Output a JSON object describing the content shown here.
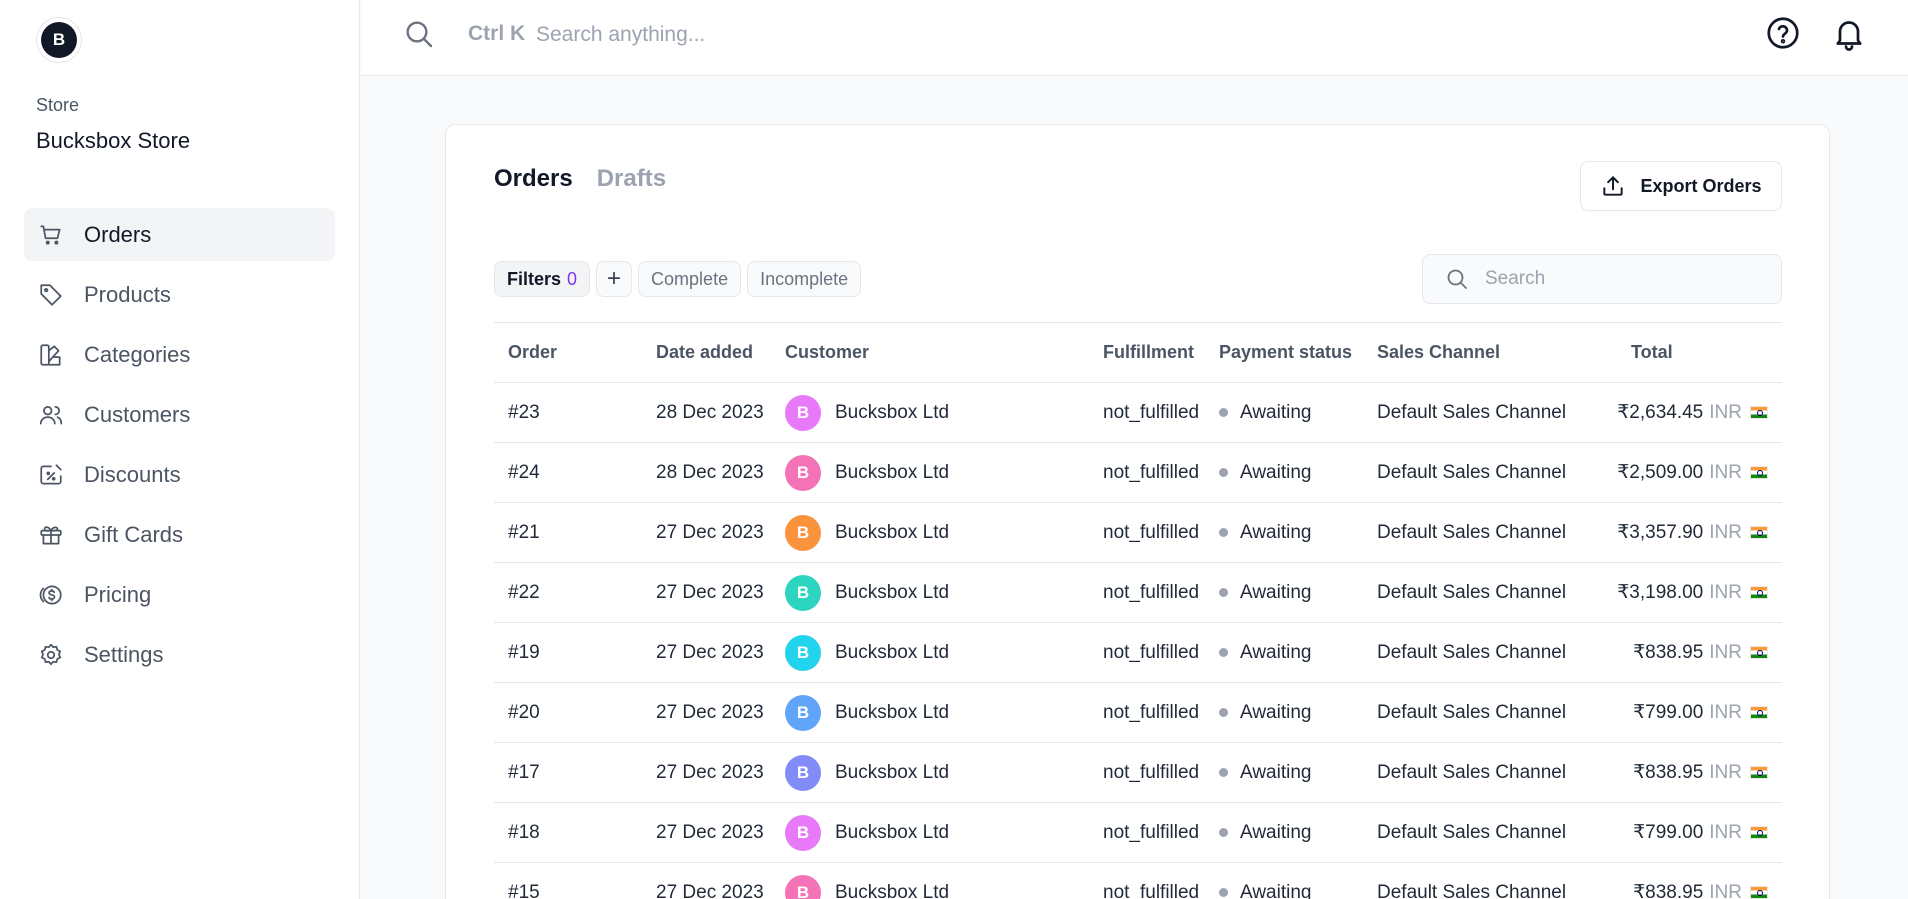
{
  "store": {
    "avatar_letter": "B",
    "label": "Store",
    "name": "Bucksbox Store"
  },
  "sidebar": {
    "items": [
      {
        "label": "Orders",
        "icon": "cart-icon",
        "active": true
      },
      {
        "label": "Products",
        "icon": "tag-icon",
        "active": false
      },
      {
        "label": "Categories",
        "icon": "swatch-icon",
        "active": false
      },
      {
        "label": "Customers",
        "icon": "users-icon",
        "active": false
      },
      {
        "label": "Discounts",
        "icon": "discount-icon",
        "active": false
      },
      {
        "label": "Gift Cards",
        "icon": "gift-icon",
        "active": false
      },
      {
        "label": "Pricing",
        "icon": "coins-icon",
        "active": false
      },
      {
        "label": "Settings",
        "icon": "gear-icon",
        "active": false
      }
    ]
  },
  "topbar": {
    "shortcut": "Ctrl K",
    "search_placeholder": "Search anything..."
  },
  "main": {
    "tabs": [
      {
        "label": "Orders",
        "active": true
      },
      {
        "label": "Drafts",
        "active": false
      }
    ],
    "export_label": "Export Orders",
    "filters_label": "Filters",
    "filters_count": "0",
    "plus_label": "+",
    "chips": [
      "Complete",
      "Incomplete"
    ],
    "search_placeholder": "Search"
  },
  "table": {
    "columns": [
      "Order",
      "Date added",
      "Customer",
      "Fulfillment",
      "Payment status",
      "Sales Channel",
      "Total"
    ],
    "rows": [
      {
        "order": "#23",
        "date": "28 Dec 2023",
        "avatar": "B",
        "avatar_color": "#e879f9",
        "customer": "Bucksbox Ltd",
        "fulfillment": "not_fulfilled",
        "payment": "Awaiting",
        "channel": "Default Sales Channel",
        "total": "₹2,634.45",
        "currency": "INR"
      },
      {
        "order": "#24",
        "date": "28 Dec 2023",
        "avatar": "B",
        "avatar_color": "#f472b6",
        "customer": "Bucksbox Ltd",
        "fulfillment": "not_fulfilled",
        "payment": "Awaiting",
        "channel": "Default Sales Channel",
        "total": "₹2,509.00",
        "currency": "INR"
      },
      {
        "order": "#21",
        "date": "27 Dec 2023",
        "avatar": "B",
        "avatar_color": "#fb923c",
        "customer": "Bucksbox Ltd",
        "fulfillment": "not_fulfilled",
        "payment": "Awaiting",
        "channel": "Default Sales Channel",
        "total": "₹3,357.90",
        "currency": "INR"
      },
      {
        "order": "#22",
        "date": "27 Dec 2023",
        "avatar": "B",
        "avatar_color": "#2dd4bf",
        "customer": "Bucksbox Ltd",
        "fulfillment": "not_fulfilled",
        "payment": "Awaiting",
        "channel": "Default Sales Channel",
        "total": "₹3,198.00",
        "currency": "INR"
      },
      {
        "order": "#19",
        "date": "27 Dec 2023",
        "avatar": "B",
        "avatar_color": "#22d3ee",
        "customer": "Bucksbox Ltd",
        "fulfillment": "not_fulfilled",
        "payment": "Awaiting",
        "channel": "Default Sales Channel",
        "total": "₹838.95",
        "currency": "INR"
      },
      {
        "order": "#20",
        "date": "27 Dec 2023",
        "avatar": "B",
        "avatar_color": "#60a5fa",
        "customer": "Bucksbox Ltd",
        "fulfillment": "not_fulfilled",
        "payment": "Awaiting",
        "channel": "Default Sales Channel",
        "total": "₹799.00",
        "currency": "INR"
      },
      {
        "order": "#17",
        "date": "27 Dec 2023",
        "avatar": "B",
        "avatar_color": "#818cf8",
        "customer": "Bucksbox Ltd",
        "fulfillment": "not_fulfilled",
        "payment": "Awaiting",
        "channel": "Default Sales Channel",
        "total": "₹838.95",
        "currency": "INR"
      },
      {
        "order": "#18",
        "date": "27 Dec 2023",
        "avatar": "B",
        "avatar_color": "#e879f9",
        "customer": "Bucksbox Ltd",
        "fulfillment": "not_fulfilled",
        "payment": "Awaiting",
        "channel": "Default Sales Channel",
        "total": "₹799.00",
        "currency": "INR"
      },
      {
        "order": "#15",
        "date": "27 Dec 2023",
        "avatar": "B",
        "avatar_color": "#f472b6",
        "customer": "Bucksbox Ltd",
        "fulfillment": "not_fulfilled",
        "payment": "Awaiting",
        "channel": "Default Sales Channel",
        "total": "₹838.95",
        "currency": "INR"
      }
    ]
  }
}
